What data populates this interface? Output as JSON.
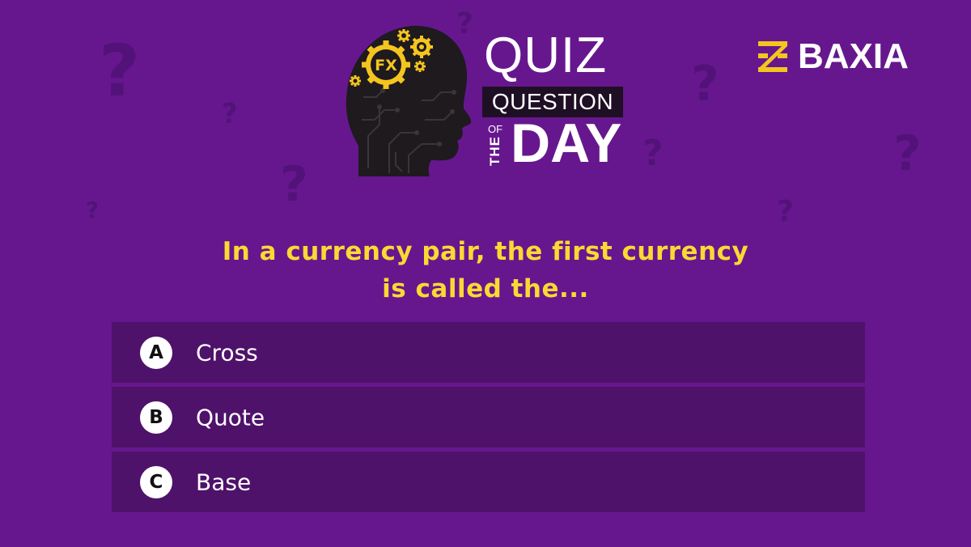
{
  "header": {
    "badge_fx": "FX",
    "title_quiz": "QUIZ",
    "title_question": "QUESTION",
    "title_of": "OF",
    "title_the": "THE",
    "title_day": "DAY"
  },
  "brand": {
    "name": "BAXIA",
    "logo_icon": "baxia-logo-icon"
  },
  "colors": {
    "background": "#66178e",
    "option_background": "#4f126a",
    "question_text": "#fdd833",
    "accent_gold": "#f5c51f",
    "question_marks": "#531279"
  },
  "question": {
    "line1": "In a currency pair, the first currency",
    "line2": "is called the..."
  },
  "options": [
    {
      "letter": "A",
      "label": "Cross"
    },
    {
      "letter": "B",
      "label": "Quote"
    },
    {
      "letter": "C",
      "label": "Base"
    }
  ],
  "decor": {
    "qmark": "?"
  }
}
